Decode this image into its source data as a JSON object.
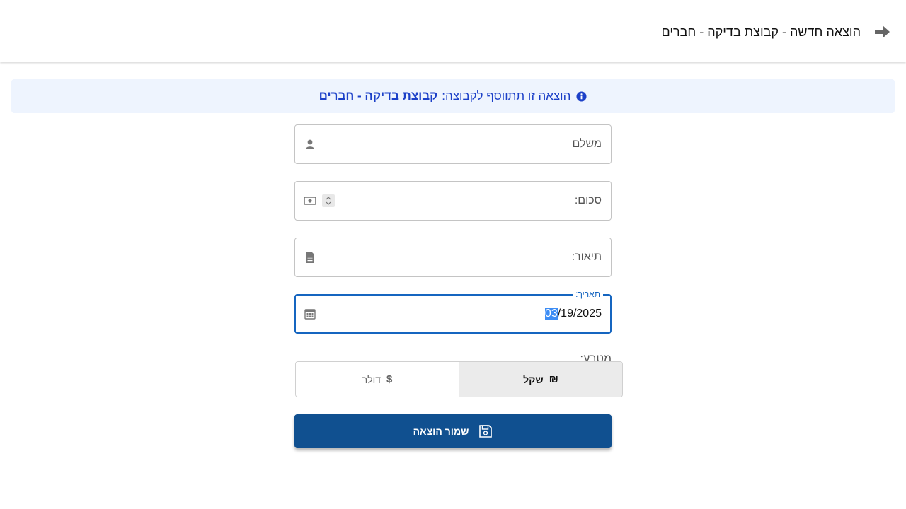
{
  "header": {
    "title": "הוצאה חדשה - קבוצת בדיקה - חברים",
    "back_icon": "arrow-right-icon"
  },
  "banner": {
    "text": "הוצאה זו תתווסף לקבוצה:",
    "group_name": "קבוצת בדיקה - חברים",
    "icon": "info-circle-icon"
  },
  "form": {
    "payer_label": "משלם",
    "amount_label": "סכום:",
    "description_label": "תיאור:",
    "date_label": "תאריך:",
    "date_month": "03",
    "date_rest": "/19/2025",
    "currency_label": "מטבע:",
    "currency_options": [
      {
        "label": "שקל",
        "symbol": "₪",
        "selected": true
      },
      {
        "label": "דולר",
        "symbol": "$",
        "selected": false
      }
    ],
    "save_label": "שמור הוצאה"
  },
  "colors": {
    "primary": "#105090",
    "banner_bg": "#eef4fe",
    "banner_text": "#1c40c8",
    "focus": "#1565c0"
  }
}
